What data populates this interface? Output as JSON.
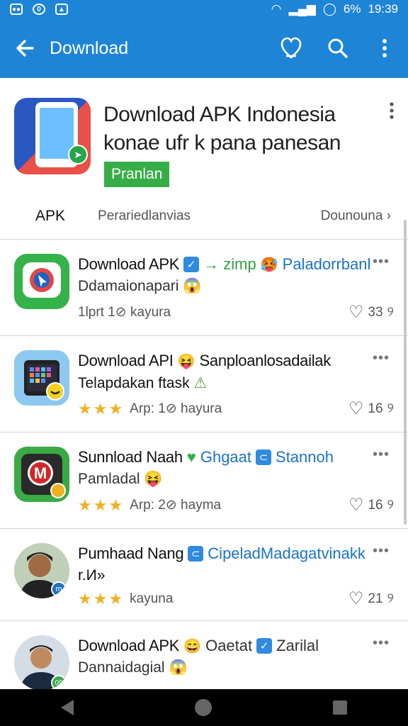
{
  "status_bar": {
    "battery_text": "6",
    "battery_pct": "6%",
    "time": "19:39"
  },
  "appbar": {
    "title": "Download"
  },
  "hero": {
    "title_line1": "Download APK Indonesia",
    "title_line2": "konae ufr k pana panesan",
    "tag": "Pranlan"
  },
  "tabs": {
    "tab1": "APK",
    "tab2": "Perariedlanvias",
    "tab3": "Dounouna ›"
  },
  "rows": [
    {
      "name": "Download APK",
      "extra1": "→ zimp",
      "emoji1": "🥵",
      "extra2": "Paladorrbanl",
      "sub": "Ddamaionapari",
      "sub_emoji": "😱",
      "meta": "1lprt 1⊘  kayura",
      "likes": "33",
      "stars": ""
    },
    {
      "name": "Download API",
      "emoji1": "😝",
      "extra1": "Sanploanlosadailak",
      "sub": "Telapdakan ftask",
      "sub_emoji": "⚠",
      "stars": "★★★",
      "meta": "Arp: 1⊘  hayura",
      "likes": "16"
    },
    {
      "name": "Sunnload Naah",
      "extra1": "Ghgaat",
      "extra2": "Stannoh",
      "sub": "Pamladal",
      "sub_emoji": "😝",
      "stars": "★★★",
      "meta": "Arp: 2⊘  hayma",
      "likes": "16"
    },
    {
      "name": "Pumhaad Nang",
      "extra1": "CipeladMadagatvinakk",
      "sub": "r.И»",
      "sub_emoji": "",
      "stars": "★★★",
      "meta": "kayuna",
      "likes": "21"
    },
    {
      "name": "Download APK",
      "emoji1": "😄",
      "extra1": "Oaetat",
      "extra2": "Zarilal",
      "sub": "Dannaidagial",
      "sub_emoji": "😱",
      "stars": "",
      "meta": "",
      "likes": ""
    }
  ],
  "avatar_badges": {
    "row4": "m",
    "row5": "09"
  },
  "colors": {
    "accent": "#1e84d6",
    "tag_green": "#37ad48",
    "star": "#f0b020"
  }
}
